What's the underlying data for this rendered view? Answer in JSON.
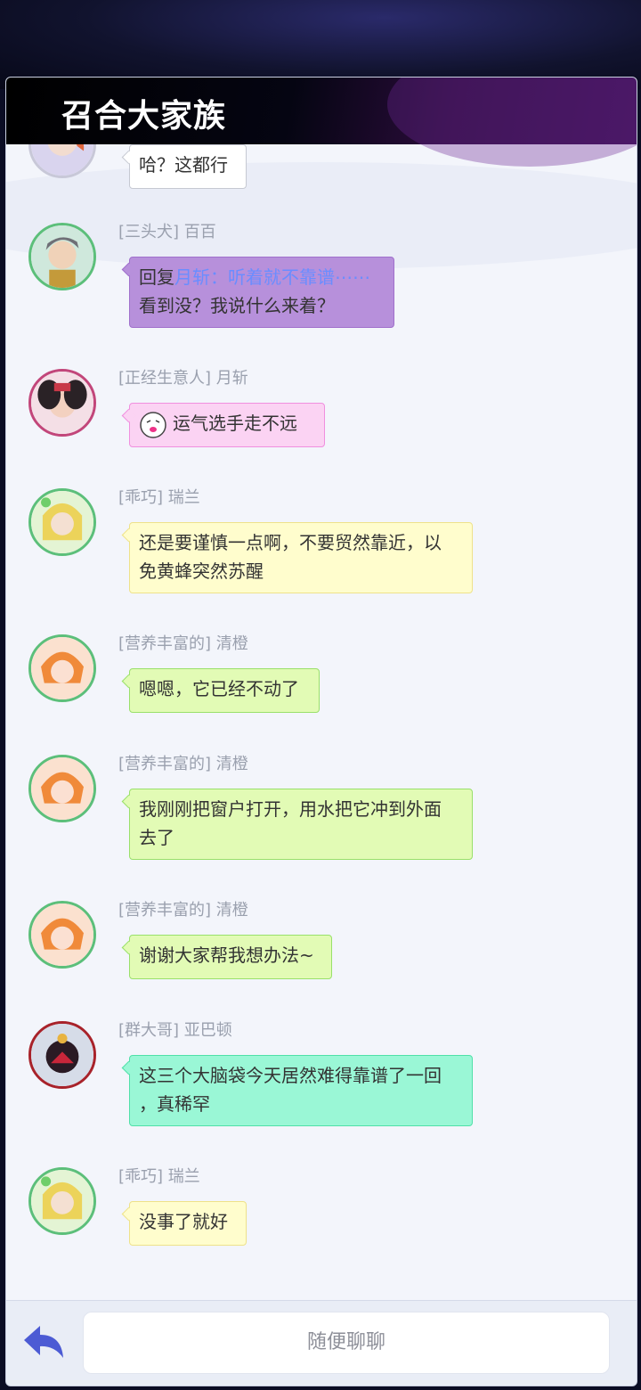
{
  "app": {
    "title": "召合大家族"
  },
  "messages": [
    {
      "text": "哈？这都行",
      "bubble": "white"
    },
    {
      "tag": "[三头犬]",
      "name": "百百",
      "reply_prefix": "回复",
      "reply_quote": "月斩：听着就不靠谱⋯⋯",
      "text": "看到没？我说什么来着？",
      "bubble": "purple"
    },
    {
      "tag": "[正经生意人]",
      "name": "月斩",
      "text": "运气选手走不远",
      "bubble": "pink"
    },
    {
      "tag": "[乖巧]",
      "name": "瑞兰",
      "text_line1": "还是要谨慎一点啊，不要贸然靠近，以",
      "text_line2": "免黄蜂突然苏醒",
      "bubble": "yellow"
    },
    {
      "tag": "[营养丰富的]",
      "name": "清橙",
      "text": "嗯嗯，它已经不动了",
      "bubble": "green"
    },
    {
      "tag": "[营养丰富的]",
      "name": "清橙",
      "text_line1": "我刚刚把窗户打开，用水把它冲到外面",
      "text_line2": "去了",
      "bubble": "green"
    },
    {
      "tag": "[营养丰富的]",
      "name": "清橙",
      "text": "谢谢大家帮我想办法~",
      "bubble": "green"
    },
    {
      "tag": "[群大哥]",
      "name": "亚巴顿",
      "text_line1": "这三个大脑袋今天居然难得靠谱了一回",
      "text_line2": "，真稀罕",
      "bubble": "teal"
    },
    {
      "tag": "[乖巧]",
      "name": "瑞兰",
      "text": "没事了就好",
      "bubble": "yellow"
    }
  ],
  "footer": {
    "input_placeholder": "随便聊聊",
    "back_icon": "back-arrow-icon"
  },
  "colors": {
    "accent_blue": "#4c5bd4",
    "quote_blue": "#6a8dff"
  }
}
